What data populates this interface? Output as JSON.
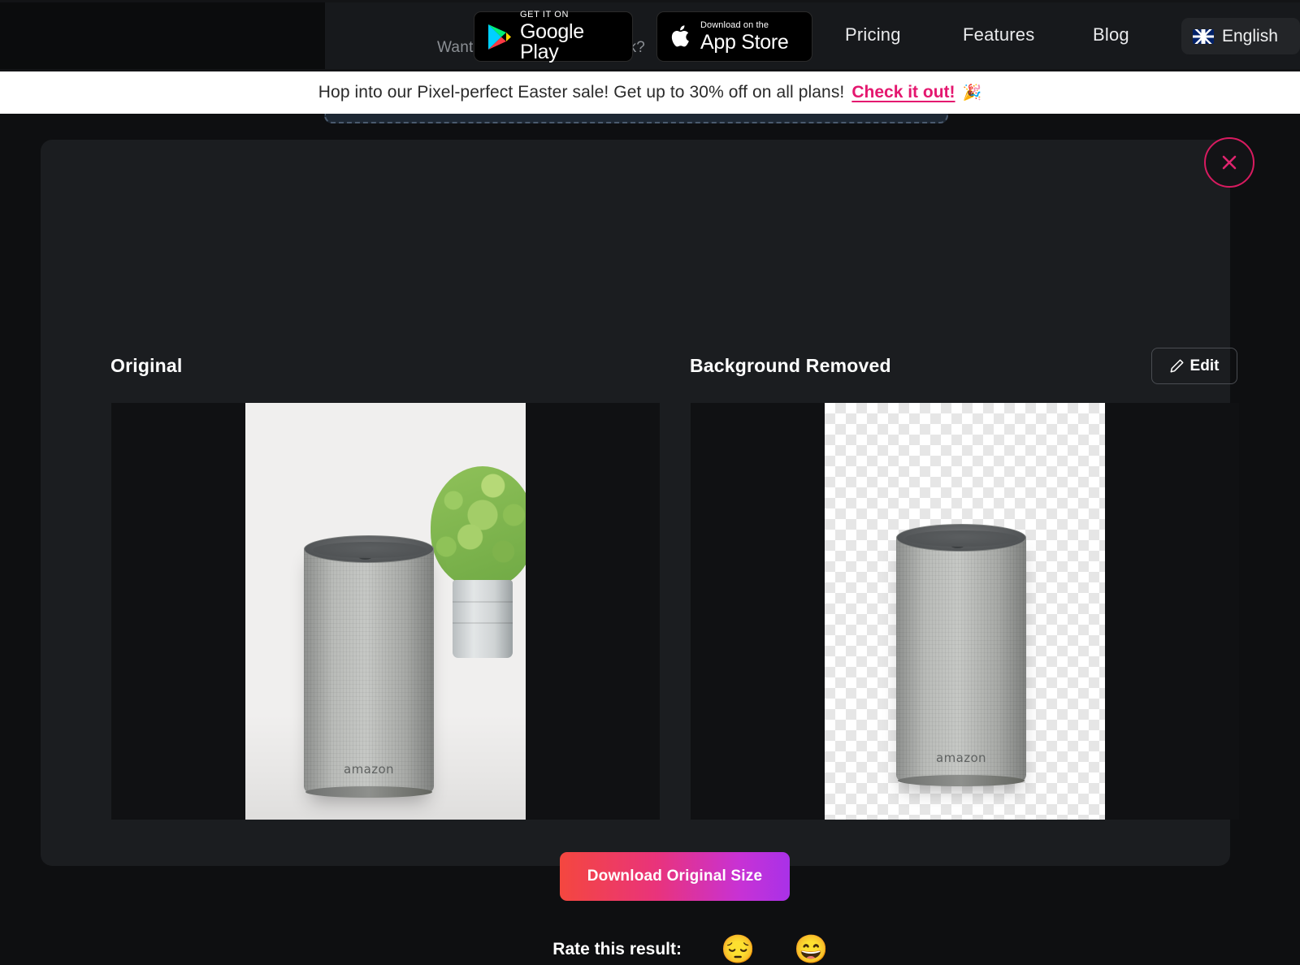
{
  "nav": {
    "teaser_text": "Want to have some fun work?",
    "store_badges": [
      {
        "name": "google-play",
        "small": "GET IT ON",
        "big": "Google Play"
      },
      {
        "name": "app-store",
        "small": "Download on the",
        "big": "App Store"
      }
    ],
    "links": [
      {
        "label": "Pricing"
      },
      {
        "label": "Features"
      },
      {
        "label": "Blog"
      }
    ],
    "language": {
      "label": "English",
      "flag": "uk-flag-icon"
    }
  },
  "banner": {
    "text": "Hop into our Pixel-perfect Easter sale! Get up to 30% off on all plans!",
    "cta": "Check it out!",
    "emoji": "🎉",
    "background": "#ffffff",
    "cta_color": "#e4176f"
  },
  "card": {
    "close_label": "close-icon",
    "panels": {
      "original": {
        "title": "Original"
      },
      "removed": {
        "title": "Background Removed"
      }
    },
    "edit_button": {
      "label": "Edit",
      "icon": "pencil-icon"
    },
    "download_button": {
      "label": "Download Original Size",
      "gradient_from": "#f4473f",
      "gradient_to": "#a931e8"
    },
    "rating": {
      "label": "Rate this result:",
      "options": [
        {
          "name": "rating-sad",
          "emoji": "😔"
        },
        {
          "name": "rating-happy",
          "emoji": "😄"
        }
      ]
    }
  },
  "theme": {
    "page_background": "#0e0f11",
    "card_background": "#1b1d20",
    "frame_background": "#101113",
    "accent_pink": "#d81b60"
  }
}
